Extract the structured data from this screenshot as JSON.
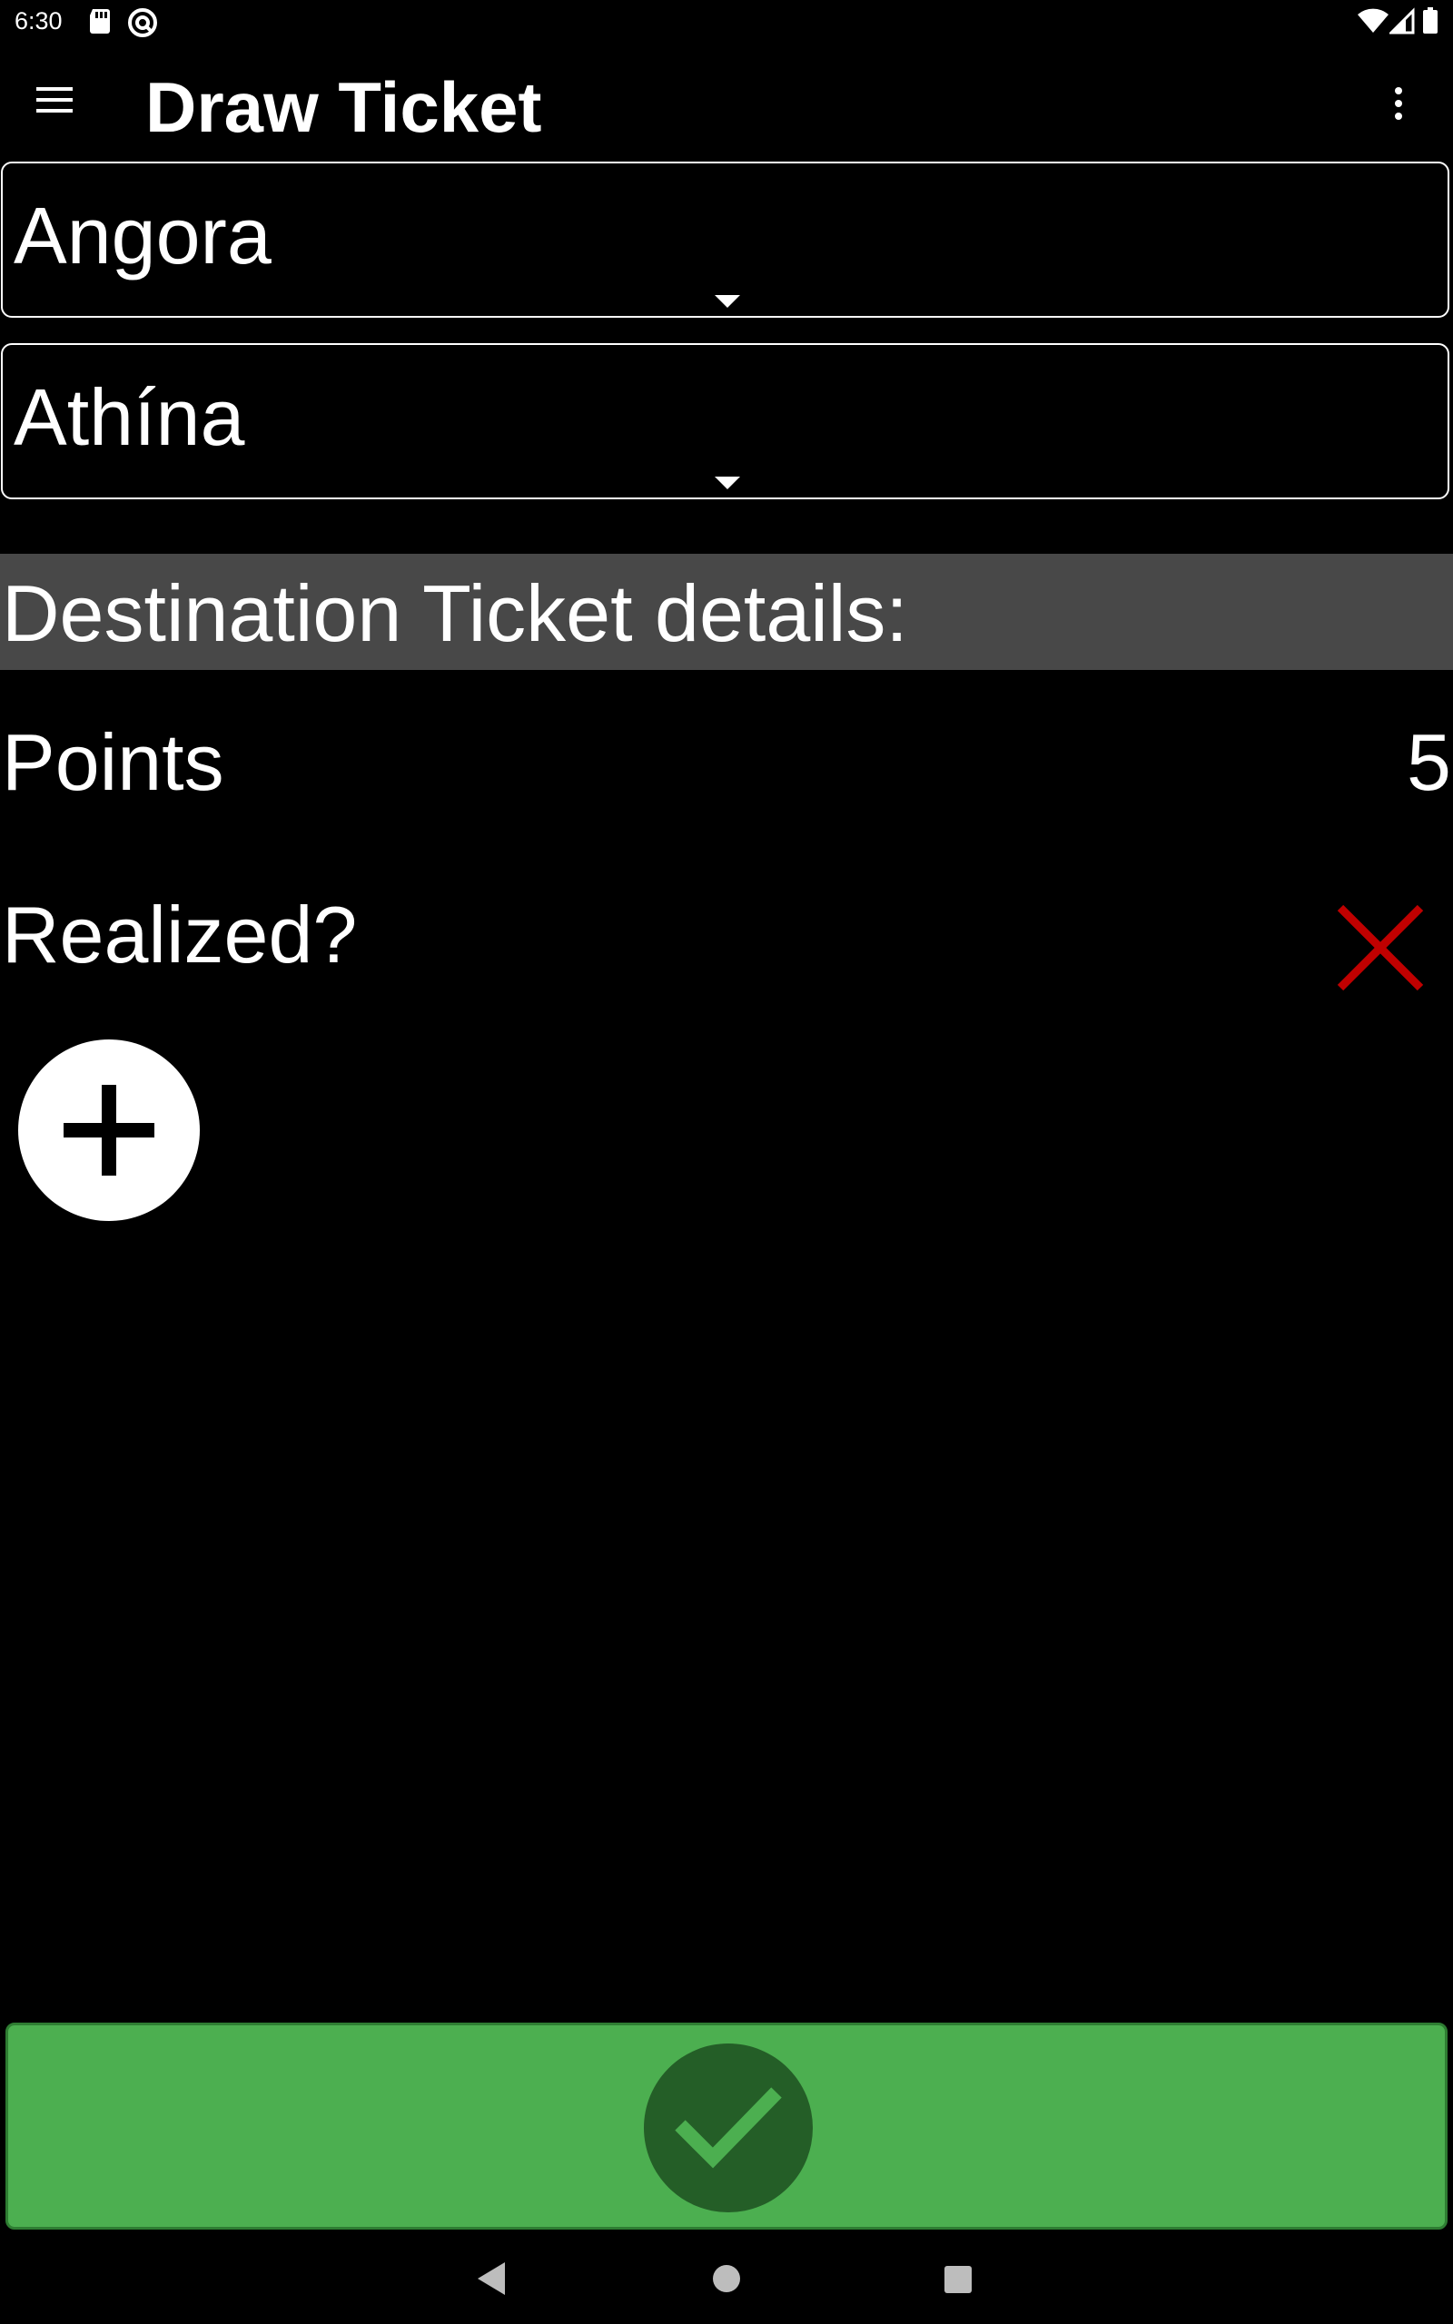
{
  "status_bar": {
    "time": "6:30",
    "left_icons": [
      "sd-card-icon",
      "sync-icon"
    ],
    "right_icons": [
      "wifi-icon",
      "signal-icon",
      "battery-icon"
    ]
  },
  "app_bar": {
    "title": "Draw Ticket",
    "menu_icon": "hamburger-menu-icon",
    "overflow_icon": "more-vert-icon"
  },
  "spinners": {
    "from": {
      "value": "Angora"
    },
    "to": {
      "value": "Athína"
    }
  },
  "details": {
    "header": "Destination Ticket details:",
    "points_label": "Points",
    "points_value": "5",
    "realized_label": "Realized?",
    "realized_icon": "close-icon",
    "realized_color": "#c00000"
  },
  "actions": {
    "add_icon": "plus-icon",
    "confirm_icon": "check-icon",
    "confirm_bar_color": "#4caf50"
  },
  "nav_bar": {
    "icons": [
      "back-icon",
      "home-icon",
      "recents-icon"
    ]
  }
}
